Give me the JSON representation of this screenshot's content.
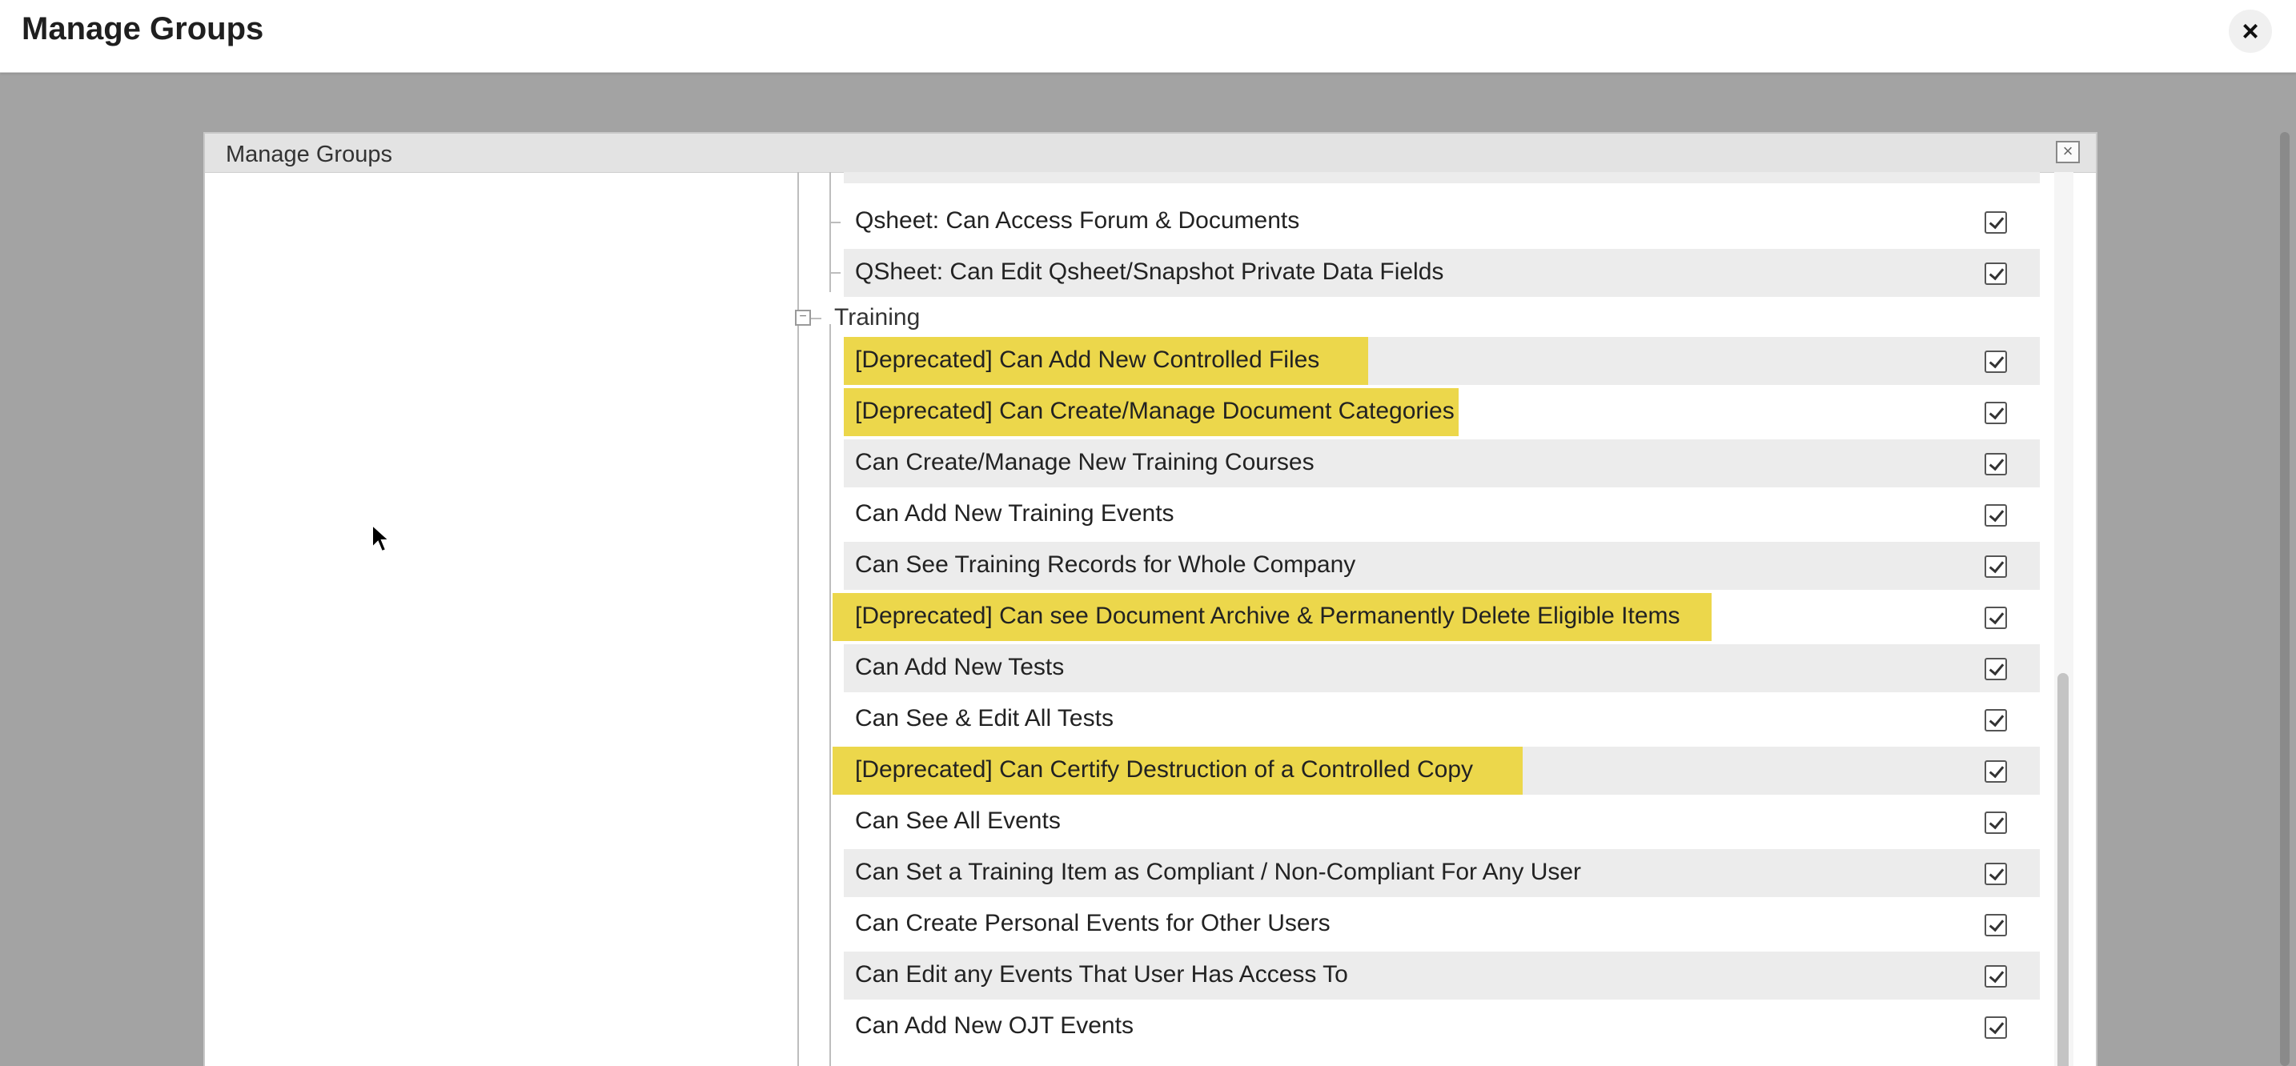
{
  "header": {
    "title": "Manage Groups",
    "close_glyph": "×"
  },
  "dialog": {
    "title": "Manage Groups",
    "close_glyph": "×"
  },
  "group": {
    "label": "Training",
    "toggle_glyph": "−"
  },
  "items_before": [
    "Qsheet: Can Access Forum & Documents",
    "QSheet: Can Edit Qsheet/Snapshot Private Data Fields"
  ],
  "items": [
    {
      "label": "[Deprecated] Can Add New Controlled Files",
      "deprecated": true,
      "checked": true
    },
    {
      "label": "[Deprecated] Can Create/Manage Document Categories",
      "deprecated": true,
      "checked": true
    },
    {
      "label": "Can Create/Manage New Training Courses",
      "deprecated": false,
      "checked": true
    },
    {
      "label": "Can Add New Training Events",
      "deprecated": false,
      "checked": true
    },
    {
      "label": "Can See Training Records for Whole Company",
      "deprecated": false,
      "checked": true
    },
    {
      "label": "[Deprecated] Can see Document Archive & Permanently Delete Eligible Items",
      "deprecated": true,
      "checked": true
    },
    {
      "label": "Can Add New Tests",
      "deprecated": false,
      "checked": true
    },
    {
      "label": "Can See & Edit All Tests",
      "deprecated": false,
      "checked": true
    },
    {
      "label": "[Deprecated] Can Certify Destruction of a Controlled Copy",
      "deprecated": true,
      "checked": true
    },
    {
      "label": "Can See All Events",
      "deprecated": false,
      "checked": true
    },
    {
      "label": "Can Set a Training Item as Compliant / Non-Compliant For Any User",
      "deprecated": false,
      "checked": true
    },
    {
      "label": "Can Create Personal Events for Other Users",
      "deprecated": false,
      "checked": true
    },
    {
      "label": "Can Edit any Events That User Has Access To",
      "deprecated": false,
      "checked": true
    },
    {
      "label": "Can Add New OJT Events",
      "deprecated": false,
      "checked": true
    }
  ],
  "colors": {
    "deprecated_highlight": "#ecd74b",
    "row_shade": "#ececec",
    "overlay": "#a3a3a3"
  },
  "icons": [
    "close-icon",
    "collapse-icon",
    "checkbox-checked-icon",
    "mouse-cursor-icon"
  ]
}
